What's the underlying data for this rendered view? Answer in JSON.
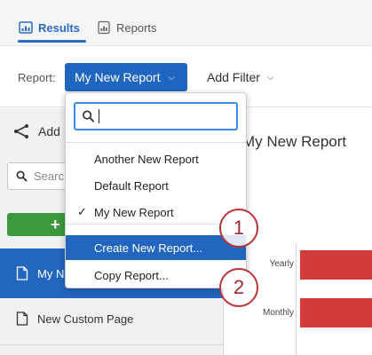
{
  "tabs": [
    {
      "label": "Results",
      "icon": "results-icon",
      "active": true
    },
    {
      "label": "Reports",
      "icon": "reports-icon",
      "active": false
    }
  ],
  "toolbar": {
    "report_label": "Report:",
    "report_selected": "My New Report",
    "add_filter_label": "Add Filter"
  },
  "sidebar": {
    "add_label": "Add",
    "search_placeholder": "Searc",
    "new_button_label": "+",
    "items": [
      {
        "label": "My N",
        "active": true
      },
      {
        "label": "New Custom Page",
        "active": false
      }
    ]
  },
  "main": {
    "title": "My New Report",
    "chart_labels": [
      "Yearly",
      "Monthly"
    ]
  },
  "dropdown": {
    "search_value": "",
    "items": [
      {
        "label": "Another New Report",
        "checked": false
      },
      {
        "label": "Default Report",
        "checked": false
      },
      {
        "label": "My New Report",
        "checked": true
      }
    ],
    "actions": [
      {
        "label": "Create New Report...",
        "highlight": true
      },
      {
        "label": "Copy Report...",
        "highlight": false
      }
    ],
    "check_glyph": "✓"
  },
  "callouts": [
    "1",
    "2"
  ],
  "colors": {
    "accent": "#2266c0",
    "tab_active": "#2a6ac4",
    "callout": "#b8343a",
    "chart_bar": "#d33b3b",
    "sidebar_green": "#3c9a3c"
  }
}
